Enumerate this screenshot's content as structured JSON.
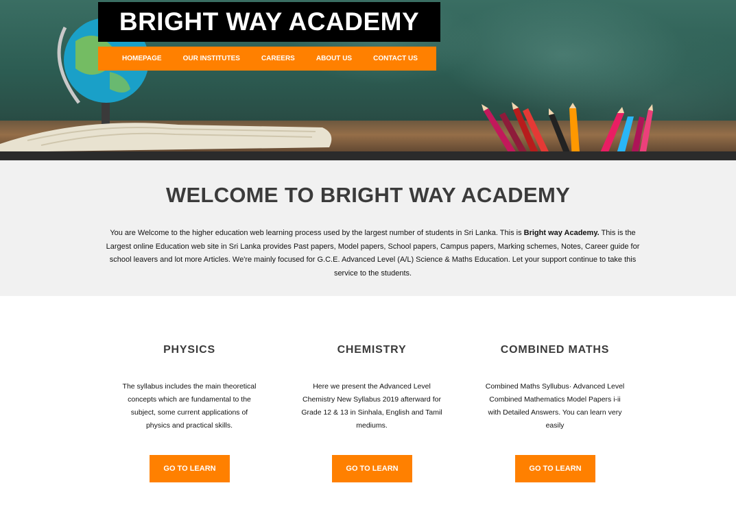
{
  "header": {
    "brand": "BRIGHT WAY ACADEMY",
    "nav": [
      "HOMEPAGE",
      "OUR INSTITUTES",
      "CAREERS",
      "ABOUT US",
      "CONTACT US"
    ]
  },
  "welcome": {
    "title": "WELCOME TO BRIGHT WAY ACADEMY",
    "text_before": "You are Welcome to the higher education web learning process used by the largest number of students in Sri Lanka. This is ",
    "text_bold": "Bright way Academy.",
    "text_after": " This is the Largest online Education web site in Sri Lanka provides Past papers, Model papers, School papers, Campus papers, Marking schemes, Notes, Career guide for school leavers and lot more Articles. We're mainly focused for G.C.E. Advanced Level (A/L) Science & Maths Education. Let your support continue to take this service to the students."
  },
  "subjects": [
    {
      "title": "PHYSICS",
      "description": "The syllabus includes the main theoretical concepts which are fundamental to the subject, some current applications of physics and practical skills.",
      "button": "GO TO LEARN"
    },
    {
      "title": "CHEMISTRY",
      "description": "Here we present the Advanced Level Chemistry New Syllabus 2019 afterward for Grade 12 & 13 in Sinhala, English and Tamil mediums.",
      "button": "GO TO LEARN"
    },
    {
      "title": "COMBINED MATHS",
      "description": "Combined Maths Syllubus· Advanced Level Combined Mathematics Model Papers i-ii with Detailed Answers. You can learn very easily",
      "button": "GO TO LEARN"
    }
  ],
  "colors": {
    "accent": "#ff8000",
    "logo_bg": "#000000",
    "welcome_bg": "#f1f1f1",
    "heading": "#3b3b3b"
  },
  "images": {
    "hero": "classroom-hero-image: chalkboard, globe, open book, colored pencils"
  }
}
